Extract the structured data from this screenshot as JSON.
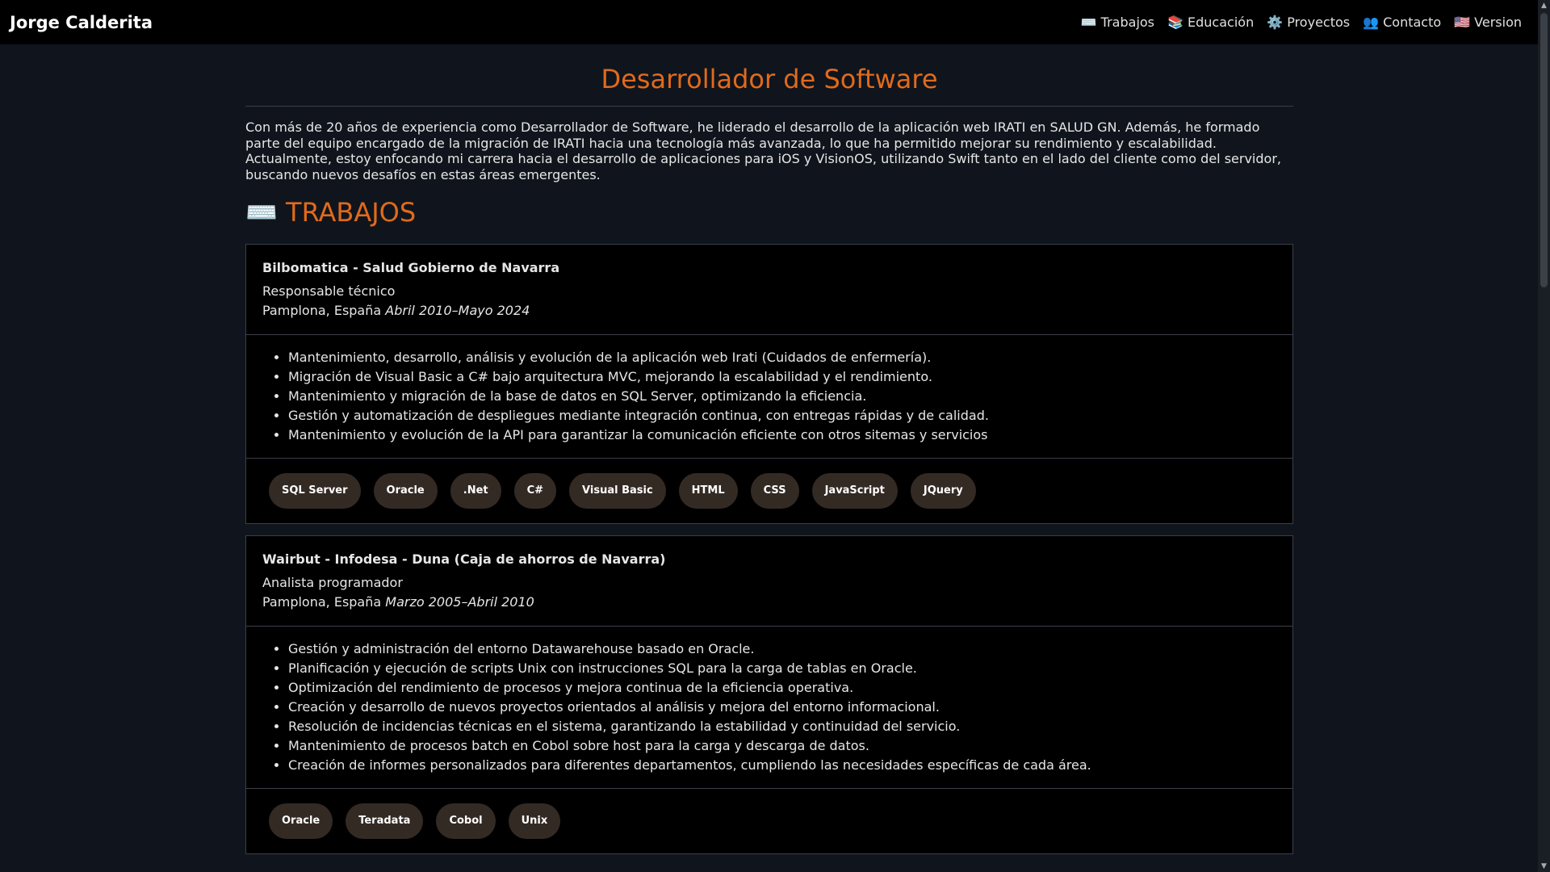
{
  "navbar": {
    "brand": "Jorge Calderita",
    "items": [
      {
        "icon": "keyboard-icon",
        "label": "⌨️ Trabajos"
      },
      {
        "icon": "books-icon",
        "label": "📚 Educación"
      },
      {
        "icon": "gear-icon",
        "label": "⚙️ Proyectos"
      },
      {
        "icon": "people-icon",
        "label": "👥 Contacto"
      },
      {
        "icon": "us-flag-icon",
        "label": "🇺🇸 Version"
      }
    ]
  },
  "header": {
    "title": "Desarrollador de Software",
    "intro": "Con más de 20 años de experiencia como Desarrollador de Software, he liderado el desarrollo de la aplicación web IRATI en SALUD GN. Además, he formado parte del equipo encargado de la migración de IRATI hacia una tecnología más avanzada, lo que ha permitido mejorar su rendimiento y escalabilidad. Actualmente, estoy enfocando mi carrera hacia el desarrollo de aplicaciones para iOS y VisionOS, utilizando Swift tanto en el lado del cliente como del servidor, buscando nuevos desafíos en estas áreas emergentes."
  },
  "section": {
    "title": "⌨️ TRABAJOS"
  },
  "jobs": [
    {
      "company": "Bilbomatica - Salud Gobierno de Navarra",
      "role": "Responsable técnico",
      "location": "Pamplona, España",
      "dates": "Abril 2010–Mayo 2024",
      "tasks": [
        "Mantenimiento, desarrollo, análisis y evolución de la aplicación web Irati (Cuidados de enfermería).",
        "Migración de Visual Basic a C# bajo arquitectura MVC, mejorando la escalabilidad y el rendimiento.",
        "Mantenimiento y migración de la base de datos en SQL Server, optimizando la eficiencia.",
        "Gestión y automatización de despliegues mediante integración continua, con entregas rápidas y de calidad.",
        "Mantenimiento y evolución de la API para garantizar la comunicación eficiente con otros sitemas y servicios"
      ],
      "tags": [
        "SQL Server",
        "Oracle",
        ".Net",
        "C#",
        "Visual Basic",
        "HTML",
        "CSS",
        "JavaScript",
        "JQuery"
      ]
    },
    {
      "company": "Wairbut - Infodesa - Duna (Caja de ahorros de Navarra)",
      "role": "Analista programador",
      "location": "Pamplona, España",
      "dates": "Marzo 2005–Abril 2010",
      "tasks": [
        "Gestión y administración del entorno Datawarehouse basado en Oracle.",
        "Planificación y ejecución de scripts Unix con instrucciones SQL para la carga de tablas en Oracle.",
        "Optimización del rendimiento de procesos y mejora continua de la eficiencia operativa.",
        "Creación y desarrollo de nuevos proyectos orientados al análisis y mejora del entorno informacional.",
        "Resolución de incidencias técnicas en el sistema, garantizando la estabilidad y continuidad del servicio.",
        "Mantenimiento de procesos batch en Cobol sobre host para la carga y descarga de datos.",
        "Creación de informes personalizados para diferentes departamentos, cumpliendo las necesidades específicas de cada área."
      ],
      "tags": [
        "Oracle",
        "Teradata",
        "Cobol",
        "Unix"
      ]
    }
  ]
}
